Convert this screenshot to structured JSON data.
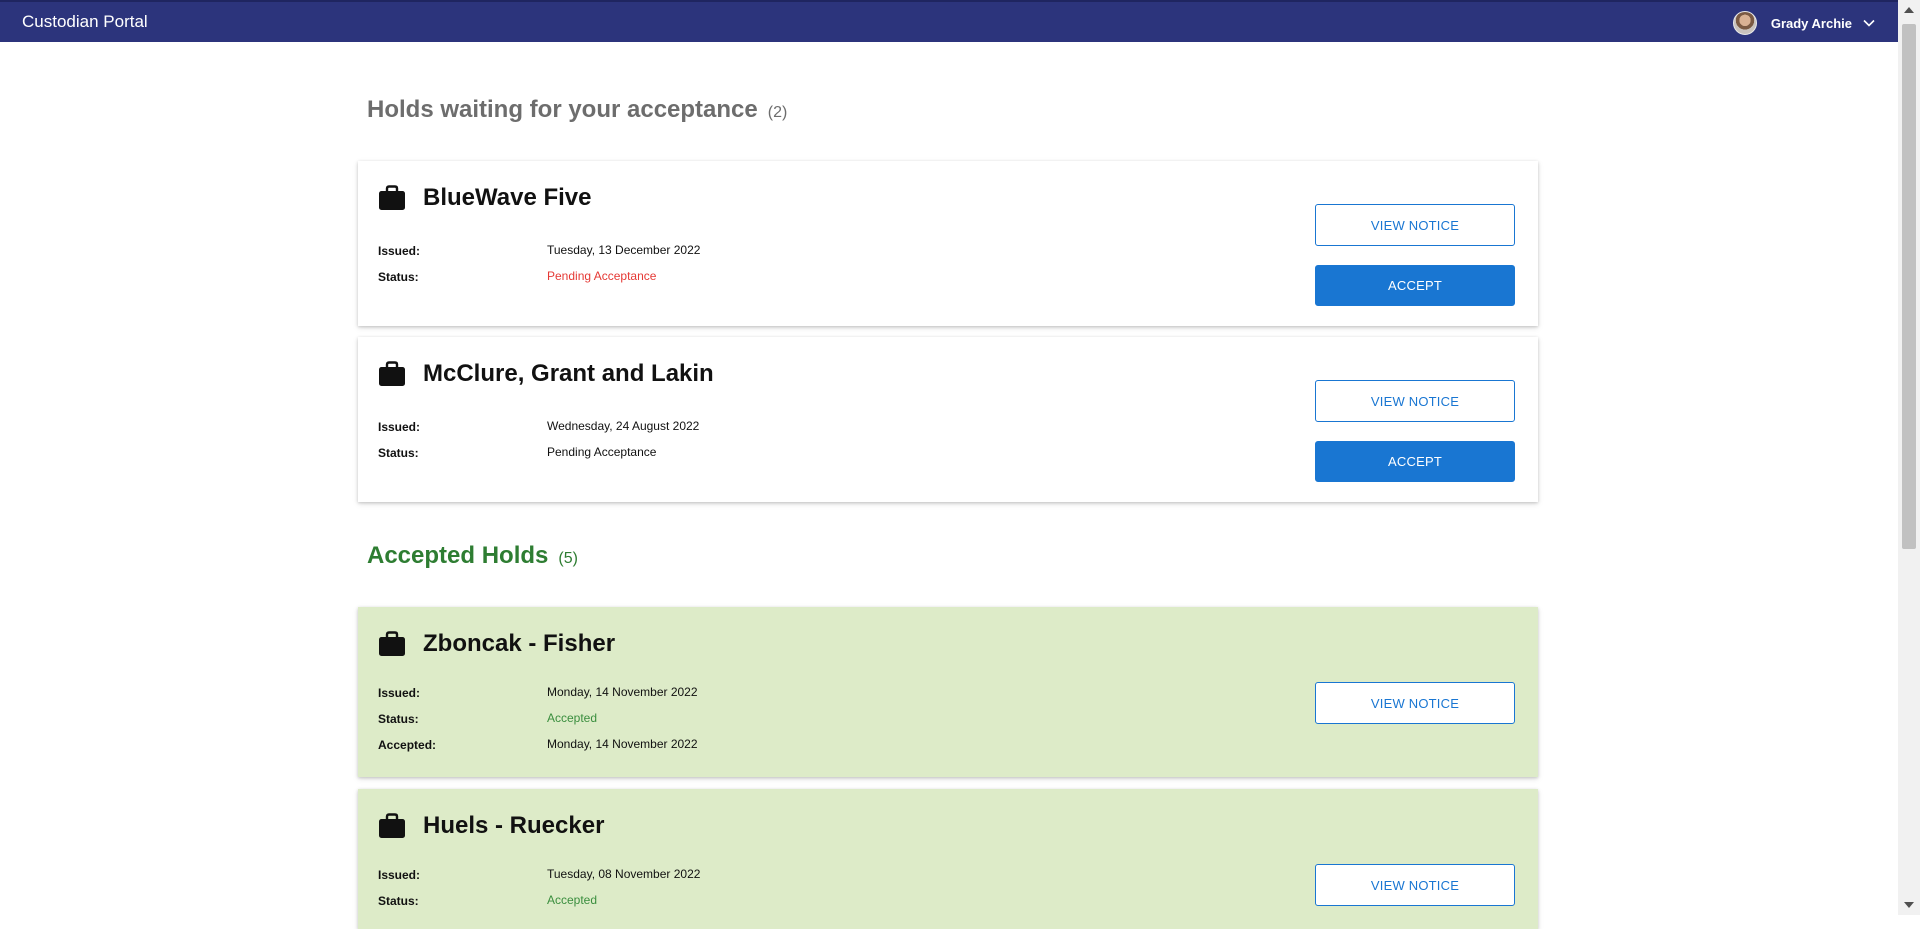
{
  "header": {
    "app_title": "Custodian Portal",
    "user_name": "Grady Archie",
    "bg_color": "#2c347c"
  },
  "sections": {
    "pending": {
      "title": "Holds waiting for your acceptance",
      "count": "(2)",
      "color": "#6d6d6d"
    },
    "accepted": {
      "title": "Accepted Holds",
      "count": "(5)",
      "color": "#2e7d32"
    }
  },
  "labels": {
    "issued": "Issued:",
    "status": "Status:",
    "accepted": "Accepted:",
    "view_notice": "VIEW NOTICE",
    "accept": "ACCEPT"
  },
  "pending_holds": [
    {
      "name": "BlueWave Five",
      "issued": "Tuesday, 13 December 2022",
      "status": "Pending Acceptance",
      "status_color": "#e53935"
    },
    {
      "name": "McClure, Grant and Lakin",
      "issued": "Wednesday, 24 August 2022",
      "status": "Pending Acceptance",
      "status_color": "#111111"
    }
  ],
  "accepted_holds": [
    {
      "name": "Zboncak - Fisher",
      "issued": "Monday, 14 November 2022",
      "status": "Accepted",
      "accepted": "Monday, 14 November 2022"
    },
    {
      "name": "Huels - Ruecker",
      "issued": "Tuesday, 08 November 2022",
      "status": "Accepted"
    }
  ],
  "icons": {
    "card": "briefcase-icon",
    "user_menu": "chevron-down-icon"
  },
  "colors": {
    "accent": "#1976d2",
    "accepted_card_bg": "#ddebc8"
  }
}
